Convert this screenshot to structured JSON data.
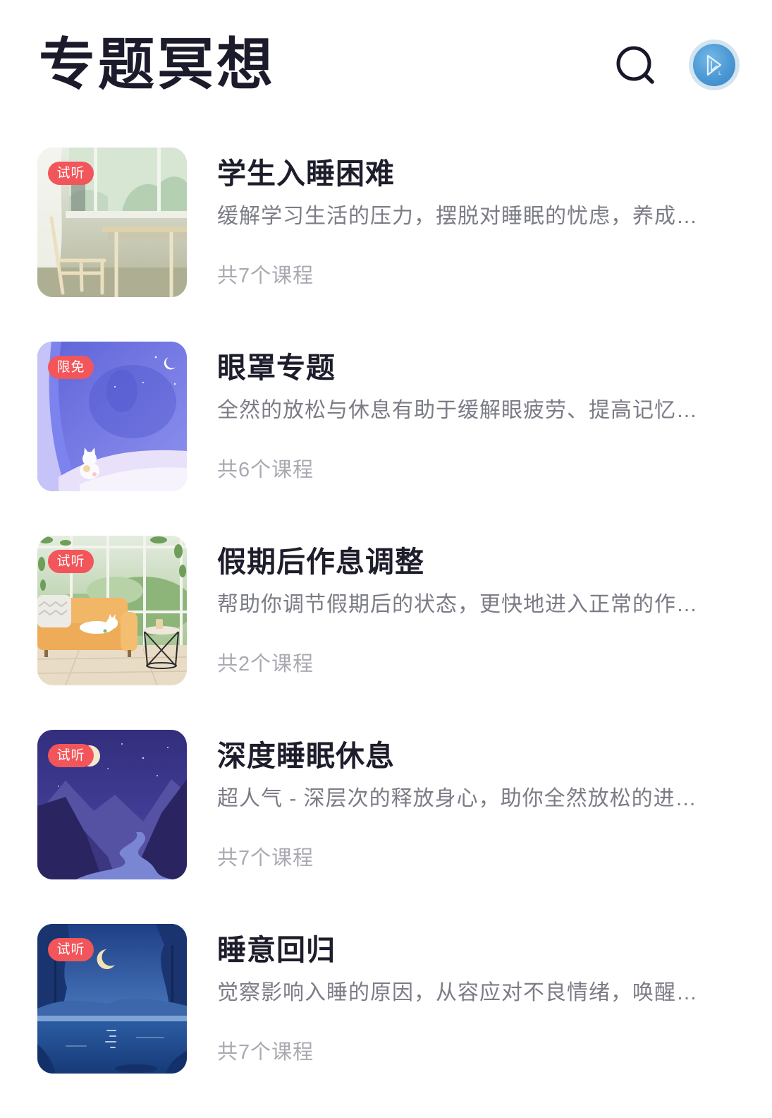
{
  "header": {
    "title": "专题冥想",
    "search_icon": "search-icon",
    "avatar_icon": "avatar"
  },
  "colors": {
    "title": "#1d1d2b",
    "description": "#7b7c86",
    "count": "#a8a9b1",
    "badge": "#f2555a"
  },
  "items": [
    {
      "title": "学生入睡困难",
      "description": "缓解学习生活的压力，摆脱对睡眠的忧虑，养成…",
      "count": "共7个课程",
      "badge": "试听",
      "thumbnail": "classroom-illustration"
    },
    {
      "title": "眼罩专题",
      "description": "全然的放松与休息有助于缓解眼疲劳、提高记忆…",
      "count": "共6个课程",
      "badge": "限免",
      "thumbnail": "night-curtain-cat-illustration"
    },
    {
      "title": "假期后作息调整",
      "description": "帮助你调节假期后的状态，更快地进入正常的作…",
      "count": "共2个课程",
      "badge": "试听",
      "thumbnail": "sofa-cat-illustration"
    },
    {
      "title": "深度睡眠休息",
      "description": "超人气 - 深层次的释放身心，助你全然放松的进…",
      "count": "共7个课程",
      "badge": "试听",
      "thumbnail": "night-mountains-river-illustration"
    },
    {
      "title": "睡意回归",
      "description": "觉察影响入睡的原因，从容应对不良情绪，唤醒…",
      "count": "共7个课程",
      "badge": "试听",
      "thumbnail": "night-lake-illustration"
    }
  ]
}
